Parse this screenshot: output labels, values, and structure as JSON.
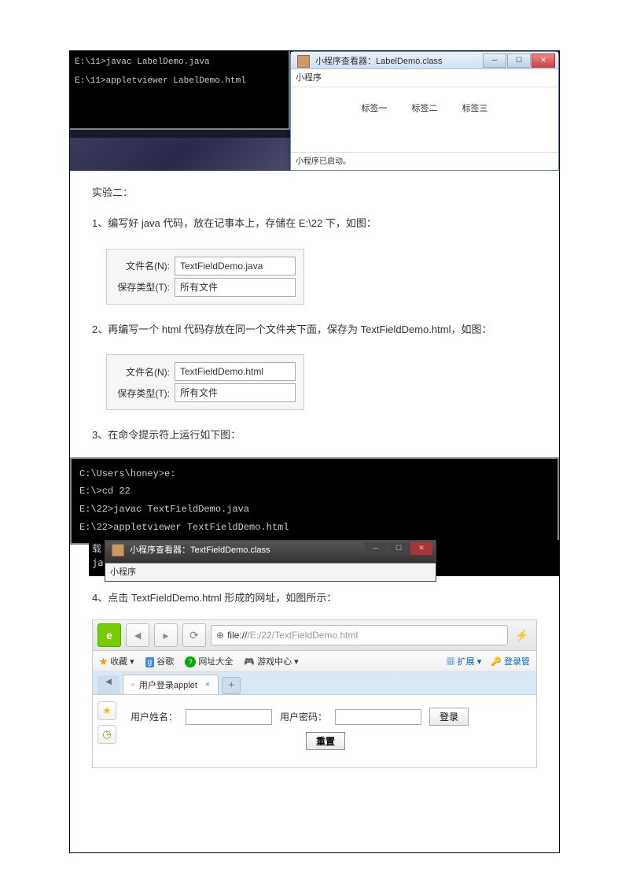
{
  "shot1": {
    "cmd_line1": "E:\\11>javac LabelDemo.java",
    "cmd_line2": "E:\\11>appletviewer LabelDemo.html",
    "win_title": "小程序查看器：LabelDemo.class",
    "win_menu": "小程序",
    "label1": "标签一",
    "label2": "标签二",
    "label3": "标签三",
    "status": "小程序已启动。"
  },
  "text": {
    "exp_title": "实验二：",
    "step1": "1、编写好 java 代码，放在记事本上，存储在 E:\\22 下，如图：",
    "step2": "2、再编写一个 html 代码存放在同一个文件夹下面，保存为 TextFieldDemo.html，如图：",
    "step3": "3、在命令提示符上运行如下图：",
    "step4": "4、点击 TextFieldDemo.html 形成的网址，如图所示："
  },
  "save1": {
    "name_lbl": "文件名(N):",
    "name_val": "TextFieldDemo.java",
    "type_lbl": "保存类型(T):",
    "type_val": "所有文件"
  },
  "save2": {
    "name_lbl": "文件名(N):",
    "name_val": "TextFieldDemo.html",
    "type_lbl": "保存类型(T):",
    "type_val": "所有文件"
  },
  "cmd2": {
    "l1": "C:\\Users\\honey>e:",
    "l2": "E:\\>cd 22",
    "l3": "E:\\22>javac TextFieldDemo.java",
    "l4": "E:\\22>appletviewer TextFieldDemo.html",
    "l5": "载",
    "l6": "ja",
    "win_title": "小程序查看器：TextFieldDemo.class",
    "win_menu": "小程序"
  },
  "browser": {
    "url_proto": "file://",
    "url_path": "/E:/22/TextFieldDemo.html",
    "fav": "收藏",
    "google": "谷歌",
    "sites": "网址大全",
    "games": "游戏中心",
    "ext": "扩展",
    "login_mgr": "登录管",
    "tab_title": "用户登录applet",
    "form_user": "用户姓名：",
    "form_pass": "用户密码：",
    "btn_login": "登录",
    "btn_reset": "重置"
  }
}
